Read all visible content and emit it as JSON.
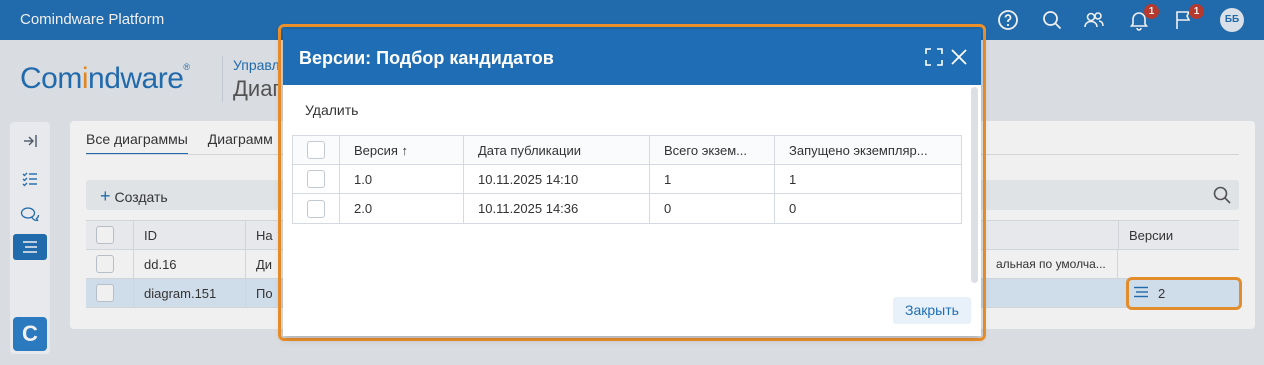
{
  "topbar": {
    "title": "Comindware Platform",
    "notifications_badge": "1",
    "messages_badge": "1",
    "avatar": "ББ"
  },
  "header": {
    "brand_prefix": "Com",
    "brand_o": "i",
    "brand_suffix": "ndware",
    "breadcrumb": "Управл",
    "page_title": "Диаг"
  },
  "rail": {
    "icons": [
      "collapse-arrow-icon",
      "checklist-icon",
      "chat-icon",
      "list-icon"
    ],
    "logo": "C"
  },
  "main": {
    "tabs": [
      {
        "label": "Все диаграммы"
      },
      {
        "label": "Диаграмм"
      }
    ],
    "create_label": "Создать",
    "grid": {
      "headers": {
        "id": "ID",
        "name": "На",
        "versions": "Версии"
      },
      "rows": [
        {
          "id": "dd.16",
          "name": "Ди",
          "extra": "альная по умолча...",
          "versions": ""
        },
        {
          "id": "diagram.151",
          "name": "По",
          "extra": "",
          "versions": "2"
        }
      ]
    }
  },
  "modal": {
    "title": "Версии: Подбор кандидатов",
    "delete_label": "Удалить",
    "close_label": "Закрыть",
    "columns": [
      "Версия ↑",
      "Дата публикации",
      "Всего экзем...",
      "Запущено экземпляр..."
    ],
    "rows": [
      {
        "version": "1.0",
        "date": "10.11.2025 14:10",
        "total": "1",
        "running": "1"
      },
      {
        "version": "2.0",
        "date": "10.11.2025 14:36",
        "total": "0",
        "running": "0"
      }
    ]
  }
}
